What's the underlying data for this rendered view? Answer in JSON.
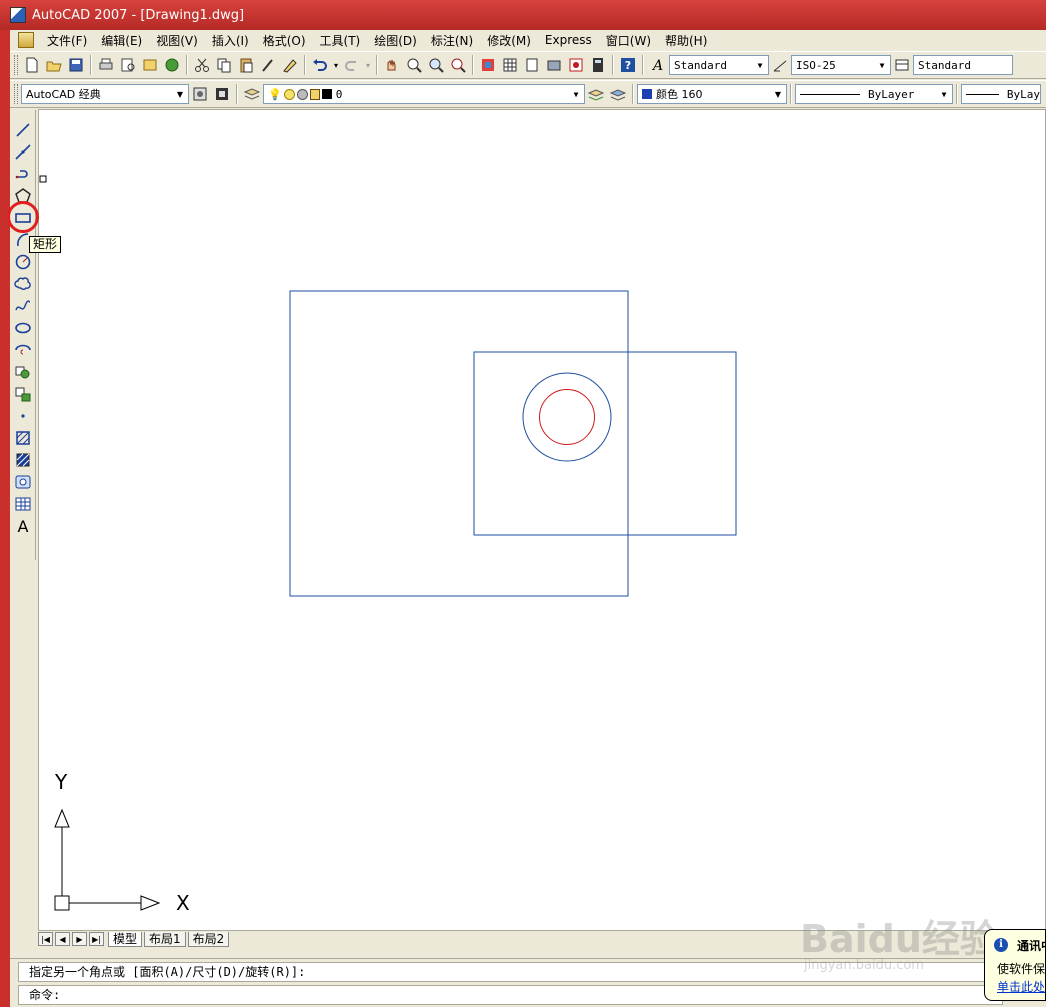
{
  "window": {
    "title": "AutoCAD 2007 - [Drawing1.dwg]"
  },
  "menu": [
    "文件(F)",
    "编辑(E)",
    "视图(V)",
    "插入(I)",
    "格式(O)",
    "工具(T)",
    "绘图(D)",
    "标注(N)",
    "修改(M)",
    "Express",
    "窗口(W)",
    "帮助(H)"
  ],
  "toolbar1": {
    "text_style": "Standard",
    "dim_style": "ISO-25",
    "table_style": "Standard"
  },
  "toolbar2": {
    "workspace": "AutoCAD 经典",
    "layer": "0",
    "color": "颜色 160",
    "color_swatch": "#1a3fb3",
    "linetype": "ByLayer",
    "lineweight": "ByLay"
  },
  "draw_toolbar": {
    "tools": [
      "line-icon",
      "construction-line-icon",
      "polyline-icon",
      "polygon-icon",
      "rectangle-icon",
      "arc-icon",
      "circle-icon",
      "revision-cloud-icon",
      "spline-icon",
      "ellipse-icon",
      "ellipse-arc-icon",
      "insert-block-icon",
      "make-block-icon",
      "point-icon",
      "hatch-icon",
      "gradient-icon",
      "region-icon",
      "table-icon",
      "multiline-text-icon"
    ],
    "tooltip": "矩形",
    "text_tool_glyph": "A"
  },
  "drawing": {
    "colors": {
      "blue": "#1f4fa0",
      "red": "#d01818"
    },
    "ucs": {
      "x_label": "X",
      "y_label": "Y"
    }
  },
  "tabs": {
    "model": "模型",
    "layout1": "布局1",
    "layout2": "布局2"
  },
  "command_line": {
    "prompt": "指定另一个角点或 [面积(A)/尺寸(D)/旋转(R)]:",
    "current": "命令:"
  },
  "balloon": {
    "title": "通讯中",
    "body": "使软件保",
    "link": "单击此处"
  },
  "watermark": {
    "text": "Baidu经验",
    "sub": "jingyan.baidu.com"
  }
}
